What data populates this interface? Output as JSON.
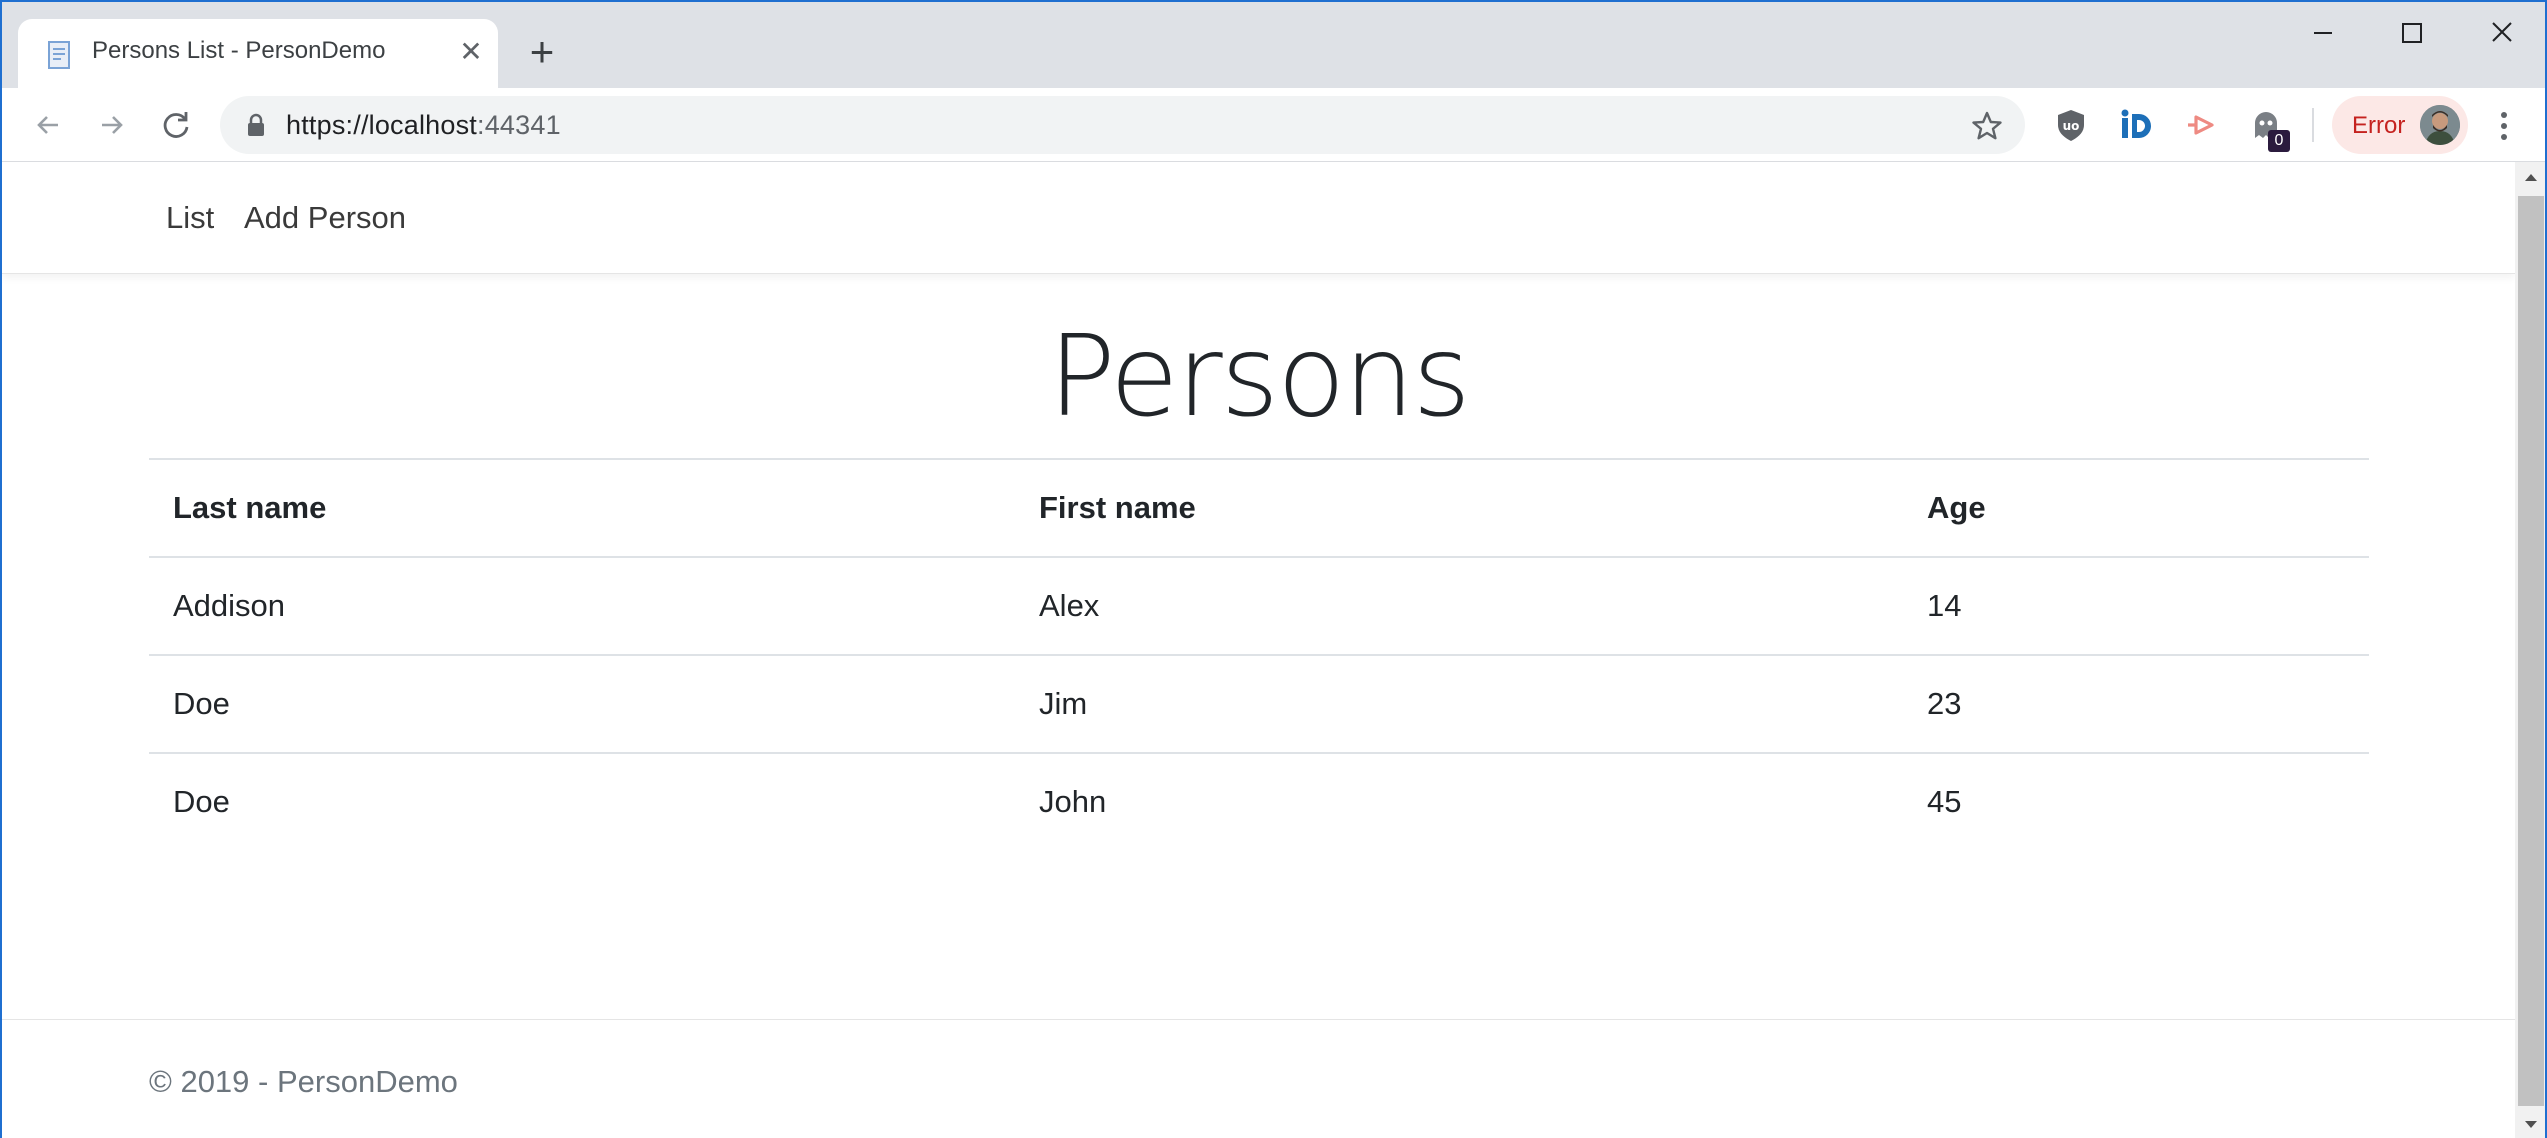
{
  "browser": {
    "tab_title": "Persons List - PersonDemo",
    "url_host": "https://localhost",
    "url_port": ":44341",
    "extension_badge": "0",
    "profile_status": "Error",
    "colors": {
      "tabstrip": "#dee1e6",
      "error_chip": "#fce8e6",
      "error_text": "#c5221f",
      "window_border": "#1f6fd0"
    }
  },
  "site_nav": {
    "items": [
      {
        "label": "List"
      },
      {
        "label": "Add Person"
      }
    ]
  },
  "main": {
    "title": "Persons",
    "table": {
      "columns": [
        "Last name",
        "First name",
        "Age"
      ],
      "rows": [
        [
          "Addison",
          "Alex",
          "14"
        ],
        [
          "Doe",
          "Jim",
          "23"
        ],
        [
          "Doe",
          "John",
          "45"
        ]
      ]
    }
  },
  "footer": {
    "text": "© 2019 - PersonDemo"
  }
}
